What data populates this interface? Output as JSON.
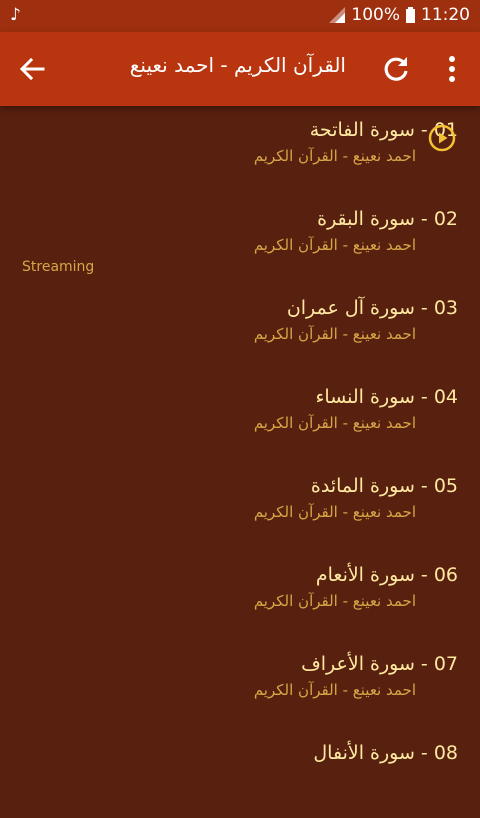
{
  "status_bar": {
    "battery": "100%",
    "time": "11:20",
    "music_icon": "music-note-icon"
  },
  "app_bar": {
    "title": "القرآن الكريم - احمد نعينع",
    "back_icon": "arrow-left-icon",
    "refresh_icon": "refresh-icon",
    "menu_icon": "more-vert-icon"
  },
  "colors": {
    "background": "#58200f",
    "app_bar": "#b8350f",
    "status_bar": "#9e2f0f",
    "title_text": "#ffe9a0",
    "subtitle_text": "#d8a646",
    "play_icon": "#f2c233"
  },
  "streaming_label": "Streaming",
  "playing_index": 1,
  "tracks": [
    {
      "title": "01 - سورة الفاتحة",
      "subtitle": "احمد نعينع - القرآن الكريم"
    },
    {
      "title": "02 - سورة البقرة",
      "subtitle": "احمد نعينع - القرآن الكريم"
    },
    {
      "title": "03 - سورة آل عمران",
      "subtitle": "احمد نعينع - القرآن الكريم"
    },
    {
      "title": "04 - سورة النساء",
      "subtitle": "احمد نعينع - القرآن الكريم"
    },
    {
      "title": "05 - سورة المائدة",
      "subtitle": "احمد نعينع - القرآن الكريم"
    },
    {
      "title": "06 - سورة الأنعام",
      "subtitle": "احمد نعينع - القرآن الكريم"
    },
    {
      "title": "07 - سورة الأعراف",
      "subtitle": "احمد نعينع - القرآن الكريم"
    },
    {
      "title": "08 - سورة الأنفال",
      "subtitle": ""
    }
  ]
}
